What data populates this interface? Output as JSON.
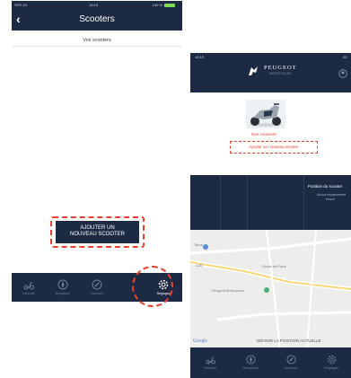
{
  "left_screen": {
    "status_bar": {
      "carrier": "SFR 4G",
      "time": "15:15",
      "battery": "100 %"
    },
    "nav": {
      "back_icon": "chevron-left-icon",
      "title": "Scooters"
    },
    "section_title": "Vos scooters",
    "add_button_line1": "AJOUTER UN",
    "add_button_line2": "NOUVEAU SCOOTER",
    "tabs": [
      {
        "label": "Véhicule",
        "icon": "scooter-icon"
      },
      {
        "label": "Navigation",
        "icon": "compass-icon"
      },
      {
        "label": "Services",
        "icon": "wrench-icon"
      },
      {
        "label": "",
        "icon": "blank"
      },
      {
        "label": "Réglages",
        "icon": "gear-icon"
      }
    ],
    "highlight_color": "#e8402f"
  },
  "right_screen": {
    "status_bar": {
      "time": "15:10",
      "signal": "4G"
    },
    "brand": "PEUGEOT",
    "brand_sub": "MOTOCYCLES",
    "status_text": "Non connecté",
    "add_link": "Ajouter un nouveau scooter",
    "position_title": "Position du scooter",
    "position_sub1": "Aucun emplacement",
    "position_sub2": "trouvé",
    "map": {
      "labels": [
        "Tours",
        "D36",
        "Route de Paris",
        "Peugeot Motocycles"
      ],
      "attribution": "Google",
      "action": "DÉFINIR LA POSITION ACTUELLE"
    },
    "tabs": [
      {
        "label": "Véhicule",
        "icon": "scooter-icon"
      },
      {
        "label": "Navigation",
        "icon": "compass-icon"
      },
      {
        "label": "Services",
        "icon": "wrench-icon"
      },
      {
        "label": "Réglages",
        "icon": "gear-icon"
      }
    ]
  },
  "colors": {
    "navy": "#1d2a44",
    "accent_red": "#e8402f",
    "map_bg": "#ededeb"
  }
}
